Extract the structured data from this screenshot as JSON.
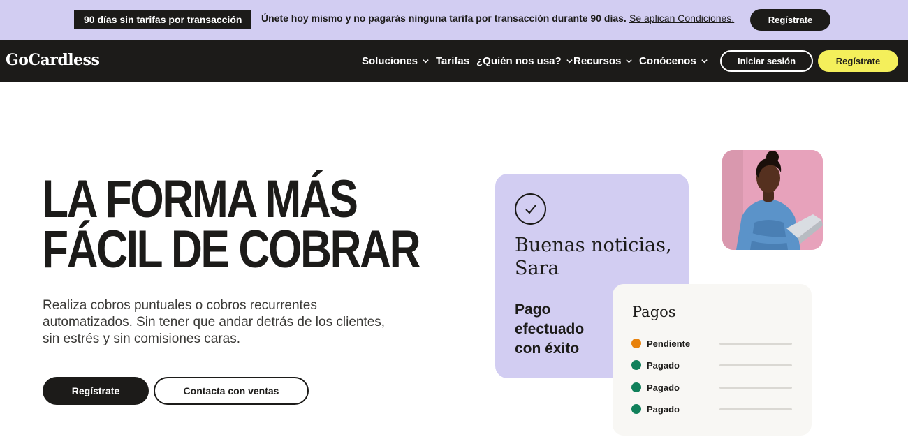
{
  "promo": {
    "badge": "90 días sin tarifas por transacción",
    "text": "Únete hoy mismo y no pagarás ninguna tarifa por transacción durante 90 días.",
    "link": "Se aplican Condiciones.",
    "button": "Regístrate"
  },
  "nav": {
    "logo": "GoCardless",
    "items": [
      {
        "label": "Soluciones",
        "dropdown": true
      },
      {
        "label": "Tarifas",
        "dropdown": false
      },
      {
        "label": "¿Quién nos usa?",
        "dropdown": true
      },
      {
        "label": "Recursos",
        "dropdown": true
      },
      {
        "label": "Conócenos",
        "dropdown": true
      }
    ],
    "login": "Iniciar sesión",
    "register": "Regístrate"
  },
  "hero": {
    "title_line1": "LA FORMA MÁS",
    "title_line2": "FÁCIL DE COBRAR",
    "subtitle": "Realiza cobros puntuales o cobros recurrentes automatizados. Sin tener que andar detrás de los clientes, sin estrés y sin comisiones caras.",
    "primary_button": "Regístrate",
    "secondary_button": "Contacta con ventas"
  },
  "card": {
    "greeting": "Buenas noticias, Sara",
    "status": "Pago efectuado con éxito"
  },
  "payments": {
    "title": "Pagos",
    "rows": [
      {
        "label": "Pendiente",
        "color": "#e8820c"
      },
      {
        "label": "Pagado",
        "color": "#10805a"
      },
      {
        "label": "Pagado",
        "color": "#10805a"
      },
      {
        "label": "Pagado",
        "color": "#10805a"
      }
    ]
  },
  "colors": {
    "promo_bg": "#d2cdf2",
    "nav_bg": "#1c1b19",
    "accent_yellow": "#f4ef5b",
    "text_dark": "#1c1b19"
  }
}
